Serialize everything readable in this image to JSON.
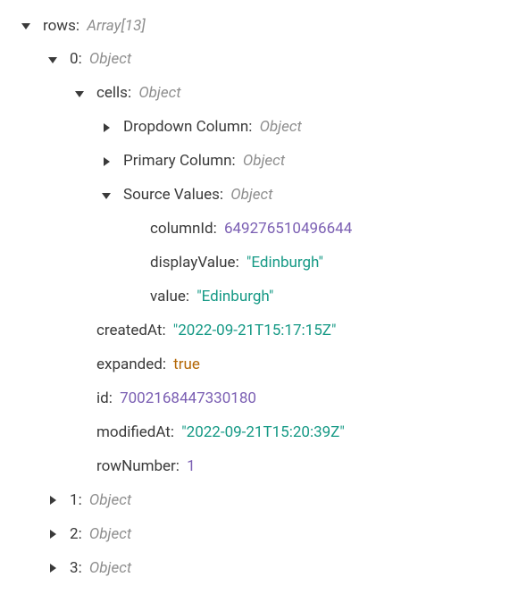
{
  "root": {
    "key": "rows",
    "type": "Array[13]"
  },
  "rows0": {
    "key": "0",
    "type": "Object"
  },
  "cells": {
    "key": "cells",
    "type": "Object"
  },
  "dropdown": {
    "key": "Dropdown Column",
    "type": "Object"
  },
  "primary": {
    "key": "Primary Column",
    "type": "Object"
  },
  "source": {
    "key": "Source Values",
    "type": "Object",
    "columnId": {
      "k": "columnId",
      "v": "649276510496644"
    },
    "displayValue": {
      "k": "displayValue",
      "v": "\"Edinburgh\""
    },
    "value": {
      "k": "value",
      "v": "\"Edinburgh\""
    }
  },
  "createdAt": {
    "k": "createdAt",
    "v": "\"2022-09-21T15:17:15Z\""
  },
  "expanded": {
    "k": "expanded",
    "v": "true"
  },
  "id": {
    "k": "id",
    "v": "7002168447330180"
  },
  "modifiedAt": {
    "k": "modifiedAt",
    "v": "\"2022-09-21T15:20:39Z\""
  },
  "rowNumber": {
    "k": "rowNumber",
    "v": "1"
  },
  "rows1": {
    "key": "1",
    "type": "Object"
  },
  "rows2": {
    "key": "2",
    "type": "Object"
  },
  "rows3": {
    "key": "3",
    "type": "Object"
  }
}
